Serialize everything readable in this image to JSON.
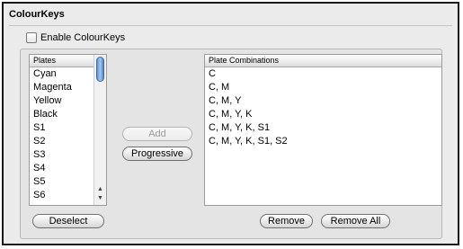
{
  "panel": {
    "title": "ColourKeys",
    "enable_checkbox": {
      "label": "Enable ColourKeys",
      "checked": false
    }
  },
  "plates_list": {
    "header": "Plates",
    "items": [
      "Cyan",
      "Magenta",
      "Yellow",
      "Black",
      "S1",
      "S2",
      "S3",
      "S4",
      "S5",
      "S6"
    ]
  },
  "combinations_list": {
    "header": "Plate Combinations",
    "items": [
      "C",
      "C, M",
      "C, M, Y",
      "C, M, Y, K",
      "C, M, Y, K, S1",
      "C, M, Y, K, S1, S2"
    ]
  },
  "buttons": {
    "add": "Add",
    "progressive": "Progressive",
    "deselect": "Deselect",
    "remove": "Remove",
    "remove_all": "Remove All"
  },
  "icons": {
    "scroll_up": "scroll-up-arrow-icon",
    "scroll_down": "scroll-down-arrow-icon"
  },
  "colors": {
    "scroll_thumb": "#5a8fd6",
    "panel_border": "#1a1a1a"
  }
}
